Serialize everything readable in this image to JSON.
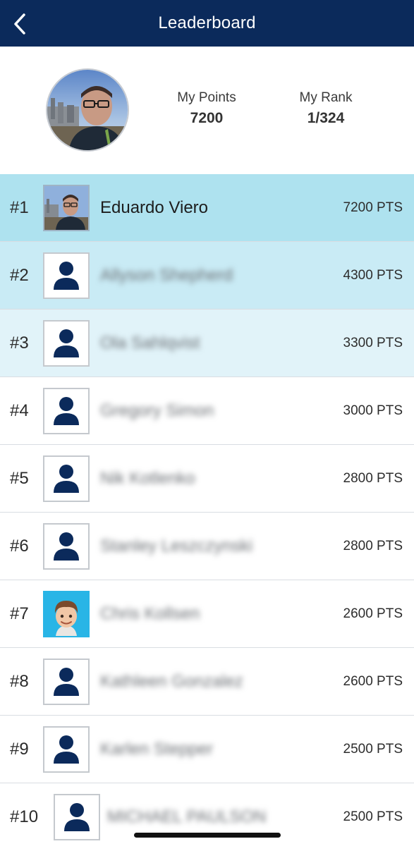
{
  "header": {
    "title": "Leaderboard",
    "background": "#0b2a5b",
    "back_icon": "chevron-left-icon"
  },
  "summary": {
    "points_label": "My Points",
    "points_value": "7200",
    "rank_label": "My Rank",
    "rank_value": "1/324"
  },
  "colors": {
    "row_1": "#aee2ef",
    "row_2": "#c9ebf5",
    "row_3": "#e1f3f9",
    "default_row": "#ffffff",
    "avatar_icon": "#0b2a5b"
  },
  "leaderboard": [
    {
      "rank": "#1",
      "name": "Eduardo Viero",
      "points": "7200 PTS",
      "avatar": "photo",
      "blurred": false
    },
    {
      "rank": "#2",
      "name": "Allyson Shepherd",
      "points": "4300 PTS",
      "avatar": "user-icon",
      "blurred": true
    },
    {
      "rank": "#3",
      "name": "Ola Sahlqvist",
      "points": "3300 PTS",
      "avatar": "user-icon",
      "blurred": true
    },
    {
      "rank": "#4",
      "name": "Gregory Simon",
      "points": "3000 PTS",
      "avatar": "user-icon",
      "blurred": true
    },
    {
      "rank": "#5",
      "name": "Nik Kotlenko",
      "points": "2800 PTS",
      "avatar": "user-icon",
      "blurred": true
    },
    {
      "rank": "#6",
      "name": "Stanley Leszczynski",
      "points": "2800 PTS",
      "avatar": "user-icon",
      "blurred": true
    },
    {
      "rank": "#7",
      "name": "Chris Kollsen",
      "points": "2600 PTS",
      "avatar": "memoji",
      "blurred": true
    },
    {
      "rank": "#8",
      "name": "Kathleen Gonzalez",
      "points": "2600 PTS",
      "avatar": "user-icon",
      "blurred": true
    },
    {
      "rank": "#9",
      "name": "Karlen Stepper",
      "points": "2500 PTS",
      "avatar": "user-icon",
      "blurred": true
    },
    {
      "rank": "#10",
      "name": "MICHAEL PAULSON",
      "points": "2500 PTS",
      "avatar": "user-icon",
      "blurred": true
    }
  ]
}
